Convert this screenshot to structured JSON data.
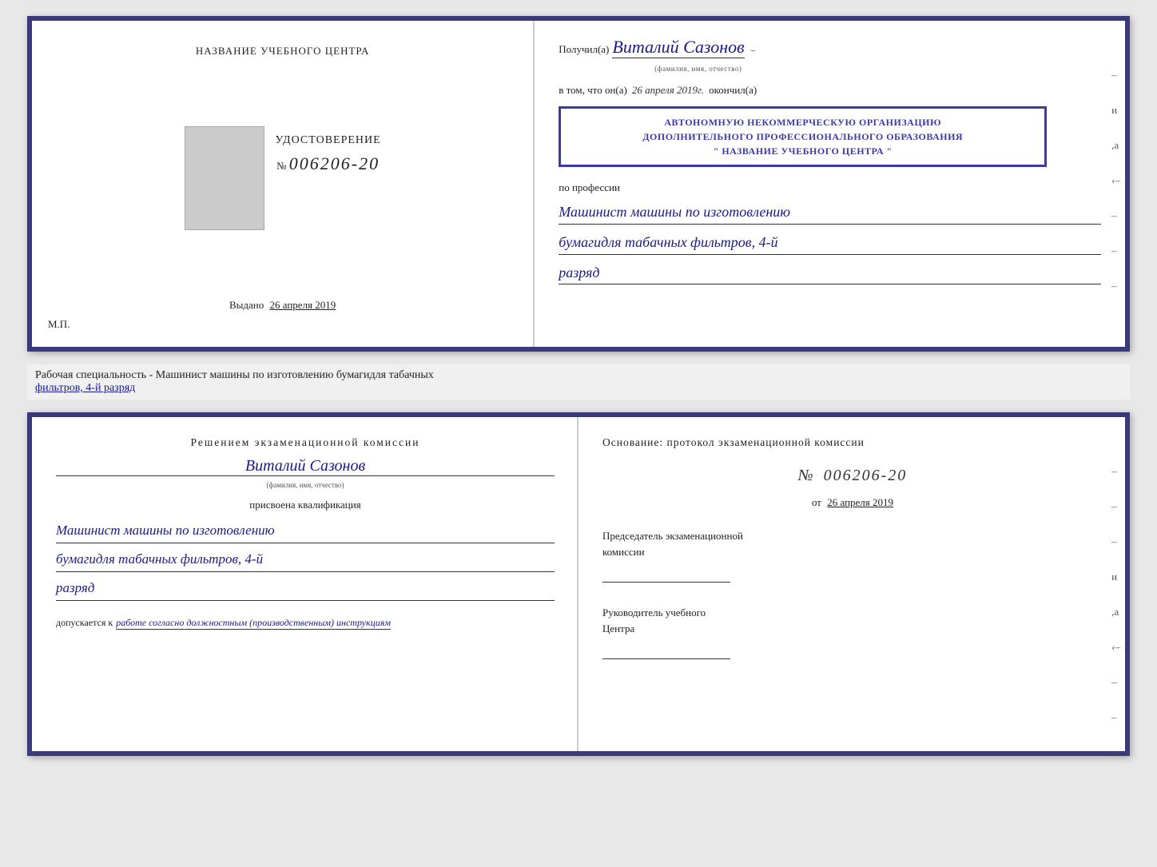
{
  "top_cert": {
    "left": {
      "title": "НАЗВАНИЕ УЧЕБНОГО ЦЕНТРА",
      "photo_alt": "фото",
      "udostoverenie": "УДОСТОВЕРЕНИЕ",
      "number_prefix": "№",
      "number": "006206-20",
      "vydano_prefix": "Выдано",
      "vydano_date": "26 апреля 2019",
      "mp": "М.П."
    },
    "right": {
      "poluchil_prefix": "Получил(а)",
      "poluchil_name": "Виталий Сазонов",
      "fio_hint": "(фамилия, имя, отчество)",
      "vtom_prefix": "в том, что он(а)",
      "vtom_date": "26 апреля 2019г.",
      "okончил_prefix": "окончил(а)",
      "stamp_line1": "АВТОНОМНУЮ НЕКОММЕРЧЕСКУЮ ОРГАНИЗАЦИЮ",
      "stamp_line2": "ДОПОЛНИТЕЛЬНОГО ПРОФЕССИОНАЛЬНОГО ОБРАЗОВАНИЯ",
      "stamp_line3": "\" НАЗВАНИЕ УЧЕБНОГО ЦЕНТРА \"",
      "po_professii": "по профессии",
      "profession1": "Машинист машины по изготовлению",
      "profession2": "бумагидля табачных фильтров, 4-й",
      "profession3": "разряд",
      "side_marks": [
        "-",
        "и",
        ",а",
        "‹-",
        "-",
        "-",
        "-",
        "-"
      ]
    }
  },
  "middle": {
    "text1": "Рабочая специальность - Машинист машины по изготовлению бумагидля табачных",
    "text2_underlined": "фильтров, 4-й разряд"
  },
  "bottom_cert": {
    "left": {
      "resheniyem": "Решением экзаменационной комиссии",
      "name": "Виталий Сазонов",
      "fio_hint": "(фамилия, имя, отчество)",
      "prisvoena": "присвоена квалификация",
      "profession1": "Машинист машины по изготовлению",
      "profession2": "бумагидля табачных фильтров, 4-й",
      "profession3": "разряд",
      "dopuskaetsya_prefix": "допускается к",
      "dopuskaetsya_text": "работе согласно должностным (производственным) инструкциям"
    },
    "right": {
      "osnovanie": "Основание: протокол экзаменационной комиссии",
      "number_prefix": "№",
      "number": "006206-20",
      "ot_prefix": "от",
      "ot_date": "26 апреля 2019",
      "predsedatel1": "Председатель экзаменационной",
      "predsedatel2": "комиссии",
      "rukovoditel1": "Руководитель учебного",
      "rukovoditel2": "Центра",
      "side_marks": [
        "-",
        "-",
        "-",
        "и",
        ",а",
        "‹-",
        "-",
        "-",
        "-",
        "-"
      ]
    }
  }
}
